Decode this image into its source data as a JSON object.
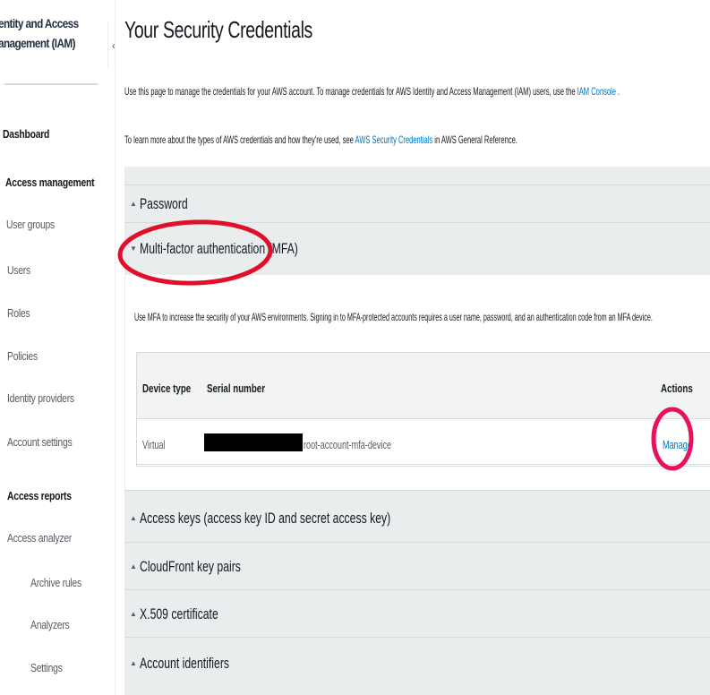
{
  "sidebar": {
    "title_line1": "entity and Access",
    "title_line2": "anagement (IAM)",
    "collapse_glyph": "‹",
    "items": [
      {
        "label": "Dashboard"
      },
      {
        "label": "Access management"
      },
      {
        "label": "User groups"
      },
      {
        "label": "Users"
      },
      {
        "label": "Roles"
      },
      {
        "label": "Policies"
      },
      {
        "label": "Identity providers"
      },
      {
        "label": "Account settings"
      },
      {
        "label": "Access reports"
      },
      {
        "label": "Access analyzer"
      },
      {
        "label": "Archive rules"
      },
      {
        "label": "Analyzers"
      },
      {
        "label": "Settings"
      }
    ]
  },
  "main": {
    "title": "Your Security Credentials",
    "intro1": {
      "before": "Use this page to manage the credentials for your AWS account. To manage credentials for AWS Identity and Access Management (IAM) users, use the ",
      "link": "IAM Console",
      "after": " ."
    },
    "intro2": {
      "before": "To learn more about the types of AWS credentials and how they're used, see ",
      "link": "AWS Security Credentials",
      "after": " in AWS General Reference."
    },
    "sections": [
      {
        "label": "Password",
        "caret": "▲"
      },
      {
        "label": "Multi-factor authentication (MFA)",
        "caret": "▼"
      },
      {
        "label": "Access keys (access key ID and secret access key)",
        "caret": "▲"
      },
      {
        "label": "CloudFront key pairs",
        "caret": "▲"
      },
      {
        "label": "X.509 certificate",
        "caret": "▲"
      },
      {
        "label": "Account identifiers",
        "caret": "▲"
      }
    ],
    "mfa": {
      "description": "Use MFA to increase the security of your AWS environments. Signing in to MFA-protected accounts requires a user name, password, and an authentication code from an MFA device.",
      "columns": {
        "device_type": "Device type",
        "serial_number": "Serial number",
        "actions": "Actions"
      },
      "row": {
        "device_type": "Virtual",
        "serial_suffix": "root-account-mfa-device",
        "action": "Manage"
      }
    }
  },
  "colors": {
    "annotation_red": "#e0102a",
    "link_blue": "#0073bb",
    "panel_gray": "#eaeded"
  }
}
